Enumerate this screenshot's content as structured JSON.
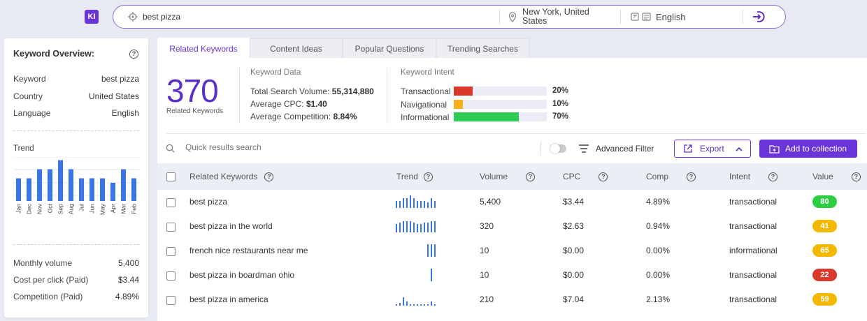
{
  "app": {
    "logo": "KI"
  },
  "search": {
    "query": "best pizza",
    "location": "New York, United States",
    "language": "English"
  },
  "overview": {
    "title": "Keyword Overview:",
    "help": "?",
    "keyword_label": "Keyword",
    "keyword": "best pizza",
    "country_label": "Country",
    "country": "United States",
    "language_label": "Language",
    "language": "English",
    "trend_label": "Trend",
    "monthly_label": "Monthly volume",
    "monthly": "5,400",
    "cpc_label": "Cost per click (Paid)",
    "cpc": "$3.44",
    "comp_label": "Competition (Paid)",
    "comp": "4.89%"
  },
  "chart_data": {
    "type": "bar",
    "categories": [
      "Jan",
      "Dec",
      "Nov",
      "Oct",
      "Sep",
      "Aug",
      "Jul",
      "Jun",
      "May",
      "Apr",
      "Mar",
      "Feb"
    ],
    "values": [
      5,
      5,
      7,
      7,
      9,
      7,
      5,
      5,
      5,
      4,
      7,
      5
    ],
    "ylim": [
      0,
      10
    ],
    "color": "#3b74e6"
  },
  "tabs": [
    "Related Keywords",
    "Content Ideas",
    "Popular Questions",
    "Trending Searches"
  ],
  "summary": {
    "count": "370",
    "count_label": "Related Keywords",
    "data_title": "Keyword Data",
    "tsv_label": "Total Search Volume:",
    "tsv": "55,314,880",
    "cpc_label": "Average CPC:",
    "cpc": "$1.40",
    "comp_label": "Average Competition:",
    "comp": "8.84%",
    "intent_title": "Keyword Intent",
    "intents": [
      {
        "label": "Transactional",
        "pct": "20%",
        "value": 0.2,
        "color": "#d9382a"
      },
      {
        "label": "Navigational",
        "pct": "10%",
        "value": 0.1,
        "color": "#f5b01b"
      },
      {
        "label": "Informational",
        "pct": "70%",
        "value": 0.7,
        "color": "#2ecc52"
      }
    ]
  },
  "toolbar": {
    "search_placeholder": "Quick results search",
    "filter": "Advanced Filter",
    "export": "Export",
    "collect": "Add to collection"
  },
  "table": {
    "headers": [
      "Related Keywords",
      "Trend",
      "Volume",
      "CPC",
      "Comp",
      "Intent",
      "Value"
    ],
    "rows": [
      {
        "keyword": "best pizza",
        "volume": "5,400",
        "cpc": "$3.44",
        "comp": "4.89%",
        "intent": "transactional",
        "value": "80",
        "value_color": "#2ecc40",
        "trend": [
          5,
          5,
          7,
          7,
          9,
          7,
          5,
          5,
          5,
          4,
          7,
          5
        ]
      },
      {
        "keyword": "best pizza in the world",
        "volume": "320",
        "cpc": "$2.63",
        "comp": "0.94%",
        "intent": "transactional",
        "value": "41",
        "value_color": "#f5b800",
        "trend": [
          6,
          7,
          8,
          8,
          8,
          7,
          6,
          6,
          7,
          7,
          8,
          8
        ]
      },
      {
        "keyword": "french nice restaurants near me",
        "volume": "10",
        "cpc": "$0.00",
        "comp": "0.00%",
        "intent": "informational",
        "value": "65",
        "value_color": "#f5b800",
        "trend": [
          0,
          0,
          0,
          0,
          0,
          0,
          0,
          0,
          0,
          9,
          9,
          9
        ]
      },
      {
        "keyword": "best pizza in boardman ohio",
        "volume": "10",
        "cpc": "$0.00",
        "comp": "0.00%",
        "intent": "transactional",
        "value": "22",
        "value_color": "#d9382a",
        "trend": [
          0,
          0,
          0,
          0,
          0,
          0,
          0,
          0,
          0,
          0,
          9,
          0
        ]
      },
      {
        "keyword": "best pizza in america",
        "volume": "210",
        "cpc": "$7.04",
        "comp": "2.13%",
        "intent": "transactional",
        "value": "59",
        "value_color": "#f5b800",
        "trend": [
          1,
          2,
          6,
          3,
          1,
          1,
          1,
          1,
          1,
          1,
          3,
          1
        ]
      }
    ]
  }
}
